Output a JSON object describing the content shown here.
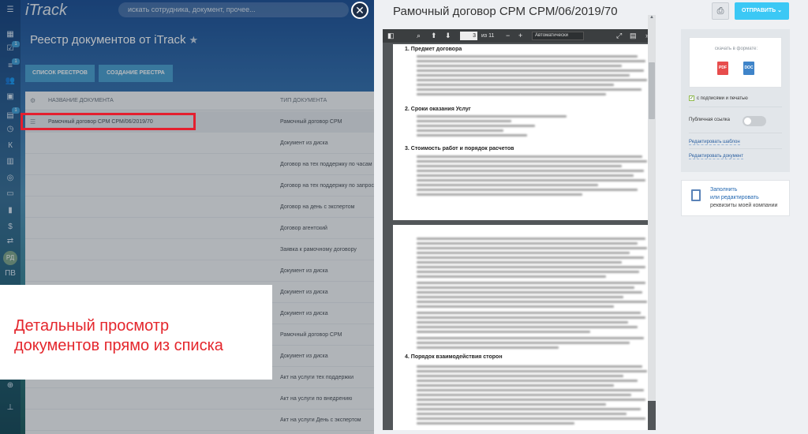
{
  "app": {
    "logo": "iTrack",
    "search_placeholder": "искать сотрудника, документ, прочее...",
    "page_title": "Реестр документов от iTrack",
    "buttons": {
      "registry_list": "СПИСОК РЕЕСТРОВ",
      "create_registry": "СОЗДАНИЕ РЕЕСТРА"
    },
    "sidebar": {
      "badges": [
        "1",
        "1",
        "1"
      ],
      "labels": [
        "К",
        "РД",
        "ПВ"
      ]
    },
    "table": {
      "columns": [
        "НАЗВАНИЕ ДОКУМЕНТА",
        "ТИП ДОКУМЕНТА"
      ],
      "rows": [
        {
          "name": "Рамочный договор СРМ СРМ/06/2019/70",
          "type": "Рамочный договор СРМ"
        },
        {
          "name": "",
          "type": "Документ из диска"
        },
        {
          "name": "",
          "type": "Договор на тех поддержку по часам"
        },
        {
          "name": "",
          "type": "Договор на тех поддержку по запросам"
        },
        {
          "name": "",
          "type": "Договор на день с экспертом"
        },
        {
          "name": "",
          "type": "Договор агентский"
        },
        {
          "name": "",
          "type": "Заявка к рамочному договору"
        },
        {
          "name": "",
          "type": "Документ из диска"
        },
        {
          "name": "",
          "type": "Документ из диска"
        },
        {
          "name": "",
          "type": "Документ из диска"
        },
        {
          "name": "",
          "type": "Рамочный договор СРМ"
        },
        {
          "name": "",
          "type": "Документ из диска"
        },
        {
          "name": "",
          "type": "Акт на услуги тех поддержки"
        },
        {
          "name": "",
          "type": "Акт на услуги по внедрению"
        },
        {
          "name": "",
          "type": "Акт на услуги День с экспертом"
        }
      ]
    },
    "promo": {
      "line1": "Детальный просмотр",
      "line2": "документов прямо из списка"
    }
  },
  "viewer": {
    "title": "Рамочный договор СРМ СРМ/06/2019/70",
    "send_label": "ОТПРАВИТЬ",
    "pdf_toolbar": {
      "page": "3",
      "of": "из 11",
      "zoom": "Автоматически"
    },
    "sections": [
      "1.   Предмет договора",
      "2.   Сроки оказания Услуг",
      "3.   Стоимость работ и порядок расчетов",
      "4.   Порядок взаимодействия сторон"
    ],
    "download": {
      "label": "скачать в формате:",
      "pdf": "PDF",
      "doc": "DOC"
    },
    "signature_checkbox": "с подписями и печатью",
    "public_link": "Публичная ссылка",
    "edit_template": "Редактировать шаблон",
    "edit_document": "Редактировать документ",
    "company": {
      "line1": "Заполнить",
      "line2": "или редактировать",
      "line3": "реквизиты моей компании"
    }
  }
}
